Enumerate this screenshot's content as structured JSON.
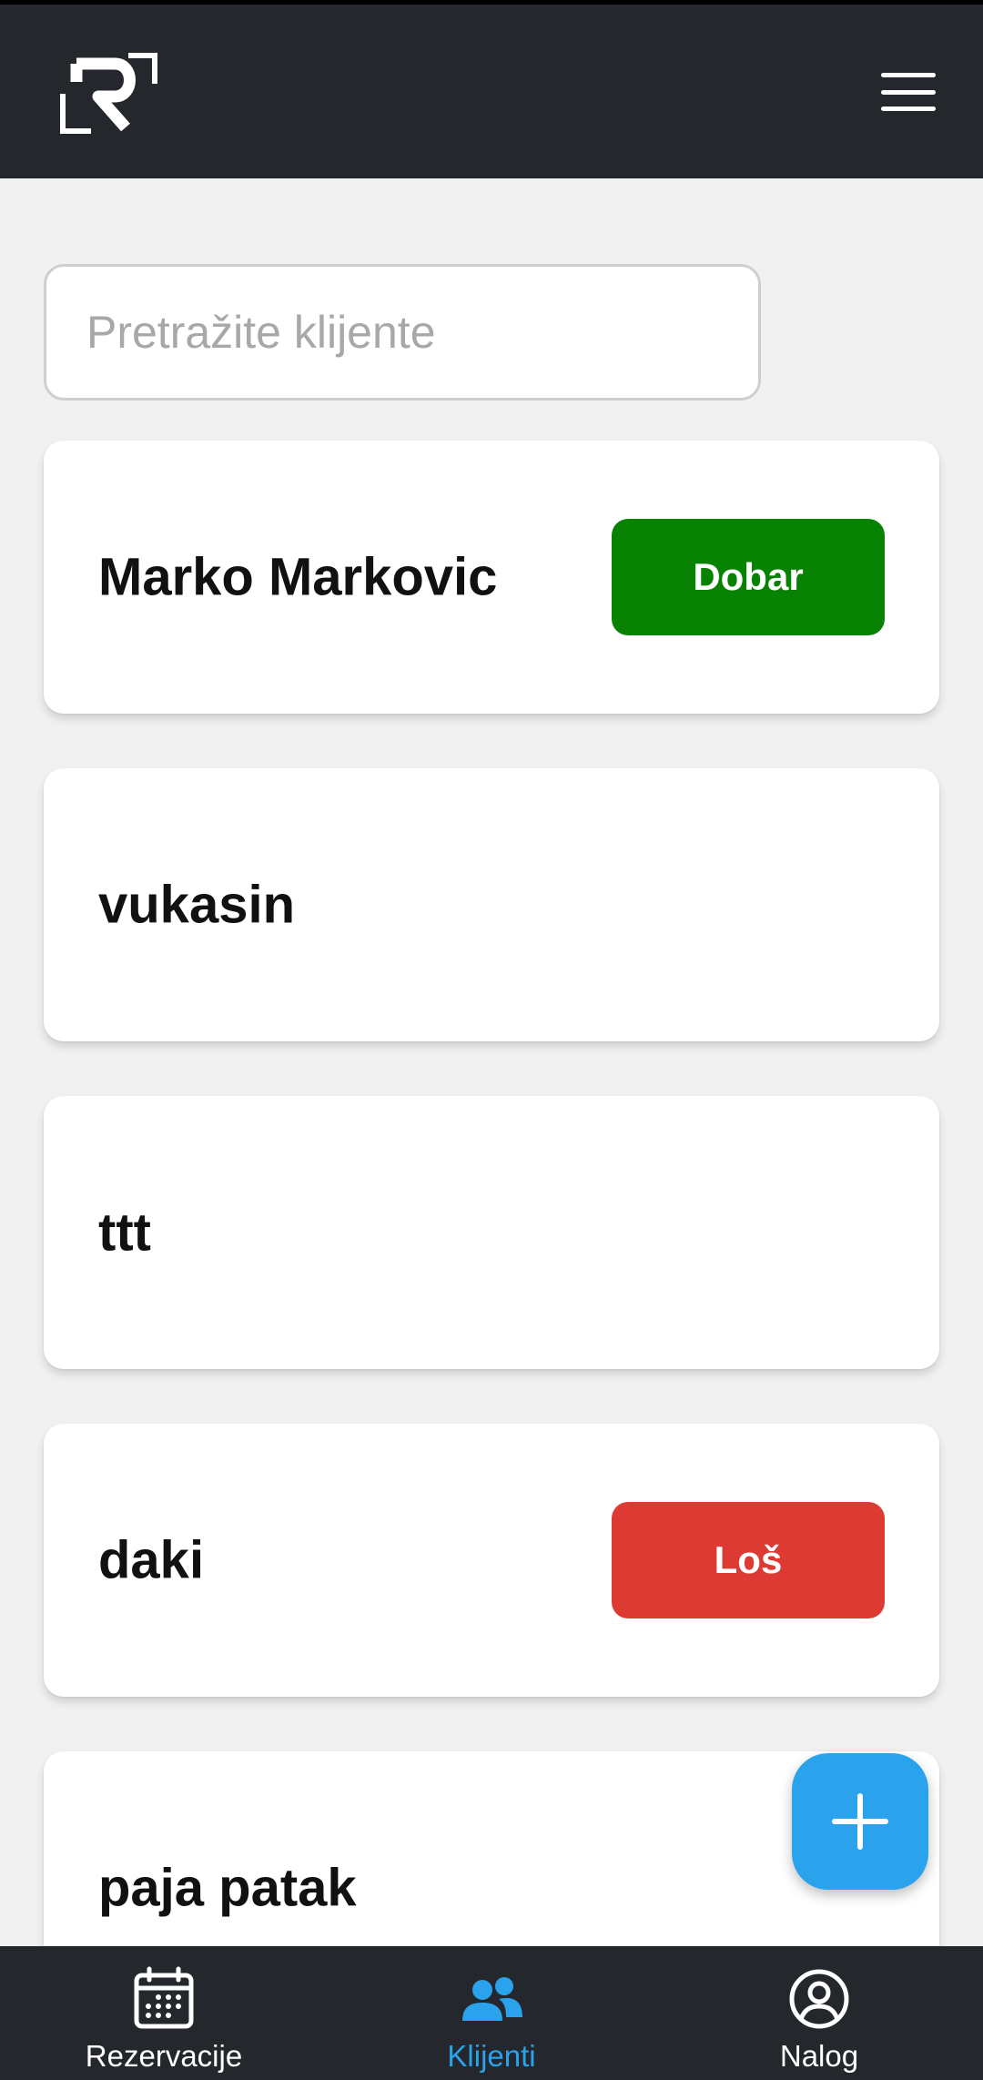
{
  "header": {
    "logo_icon": "r-logo-icon",
    "menu_icon": "hamburger-menu-icon"
  },
  "search": {
    "placeholder": "Pretražite klijente",
    "value": ""
  },
  "clients": [
    {
      "name": "Marko Markovic",
      "rating": "Dobar",
      "rating_color": "#078203"
    },
    {
      "name": "vukasin",
      "rating": "",
      "rating_color": ""
    },
    {
      "name": "ttt",
      "rating": "",
      "rating_color": ""
    },
    {
      "name": "daki",
      "rating": "Loš",
      "rating_color": "#dc3a33"
    },
    {
      "name": "paja patak",
      "rating": "",
      "rating_color": ""
    }
  ],
  "fab": {
    "icon": "plus-icon",
    "color": "#2aa2ec"
  },
  "bottom_nav": {
    "items": [
      {
        "label": "Rezervacije",
        "icon": "calendar-icon",
        "active": false
      },
      {
        "label": "Klijenti",
        "icon": "users-icon",
        "active": true
      },
      {
        "label": "Nalog",
        "icon": "account-circle-icon",
        "active": false
      }
    ]
  },
  "colors": {
    "header_bg": "#24272c",
    "accent": "#2aa2ec",
    "page_bg": "#f1f1f1"
  }
}
